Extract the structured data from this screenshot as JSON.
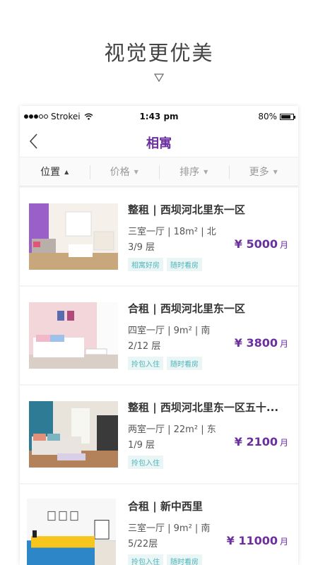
{
  "promo": {
    "title": "视觉更优美"
  },
  "status_bar": {
    "carrier": "Strokei",
    "time": "1:43 pm",
    "battery": "80%",
    "battery_level": 0.8
  },
  "nav": {
    "title": "相寓"
  },
  "filters": [
    {
      "label": "位置",
      "active": true
    },
    {
      "label": "价格",
      "active": false
    },
    {
      "label": "排序",
      "active": false
    },
    {
      "label": "更多",
      "active": false
    }
  ],
  "listings": [
    {
      "title": "整租 | 西坝河北里东一区",
      "line1": "三室一厅 | 18m² | 北",
      "line2": "3/9 层",
      "price": "¥ 5000",
      "unit": "月",
      "tags": [
        "相寓好房",
        "随时看房"
      ]
    },
    {
      "title": "合租 | 西坝河北里东一区",
      "line1": "四室一厅 | 9m² | 南",
      "line2": "2/12 层",
      "price": "¥ 3800",
      "unit": "月",
      "tags": [
        "拎包入住",
        "随时看房"
      ]
    },
    {
      "title": "整租 | 西坝河北里东一区五十...",
      "line1": "两室一厅 | 22m² | 东",
      "line2": "1/9 层",
      "price": "¥ 2100",
      "unit": "月",
      "tags": [
        "拎包入住"
      ]
    },
    {
      "title": "合租 | 新中西里",
      "line1": "三室一厅 | 9m² | 南",
      "line2": "5/22层",
      "price": "¥ 11000",
      "unit": "月",
      "tags": [
        "拎包入住",
        "随时看房"
      ]
    }
  ],
  "colors": {
    "accent": "#6b2fa0",
    "tag_text": "#4fb3b9",
    "tag_bg": "#eaf6f6"
  }
}
